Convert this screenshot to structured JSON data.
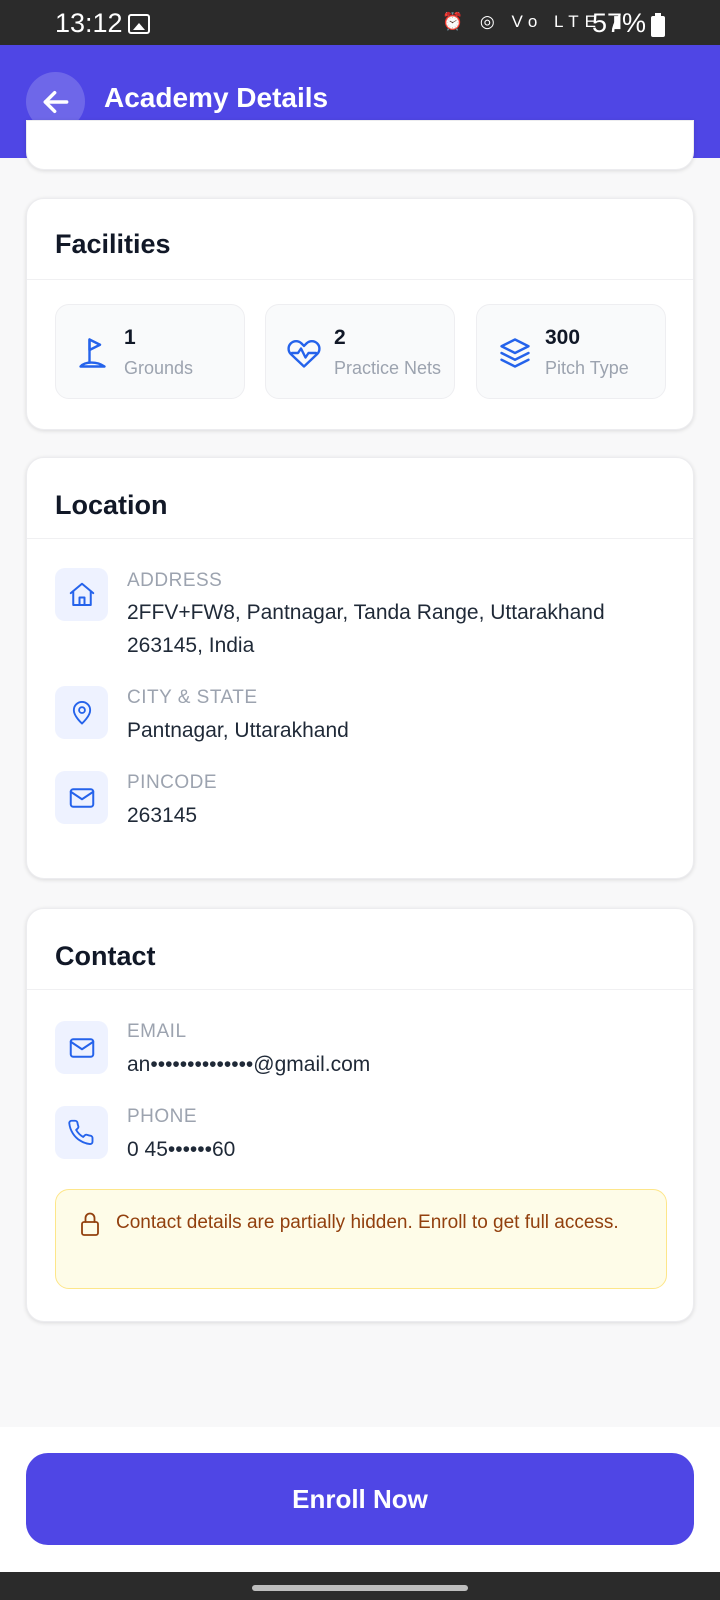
{
  "status_bar": {
    "time": "13:12",
    "icons": "⏰ ◎ Vo LTE ▮",
    "battery": "57%"
  },
  "header": {
    "title": "Academy Details"
  },
  "facilities": {
    "title": "Facilities",
    "items": [
      {
        "value": "1",
        "label": "Grounds",
        "icon": "flag-icon"
      },
      {
        "value": "2",
        "label": "Practice Nets",
        "icon": "heart-pulse-icon"
      },
      {
        "value": "300",
        "label": "Pitch Type",
        "icon": "layers-icon"
      }
    ]
  },
  "location": {
    "title": "Location",
    "rows": [
      {
        "label": "ADDRESS",
        "value": "2FFV+FW8, Pantnagar, Tanda Range, Uttarakhand 263145, India",
        "icon": "home-icon"
      },
      {
        "label": "CITY & STATE",
        "value": "Pantnagar, Uttarakhand",
        "icon": "map-pin-icon"
      },
      {
        "label": "PINCODE",
        "value": "263145",
        "icon": "mail-icon"
      }
    ]
  },
  "contact": {
    "title": "Contact",
    "rows": [
      {
        "label": "EMAIL",
        "value": "an••••••••••••••@gmail.com",
        "icon": "mail-icon"
      },
      {
        "label": "PHONE",
        "value": "0 45••••••60",
        "icon": "phone-icon"
      }
    ],
    "notice": "Contact details are partially hidden. Enroll to get full access."
  },
  "actions": {
    "enroll_label": "Enroll Now"
  },
  "colors": {
    "primary": "#4f46e5",
    "icon_blue": "#2563eb",
    "notice_bg": "#fefce8",
    "notice_text": "#92400e"
  }
}
